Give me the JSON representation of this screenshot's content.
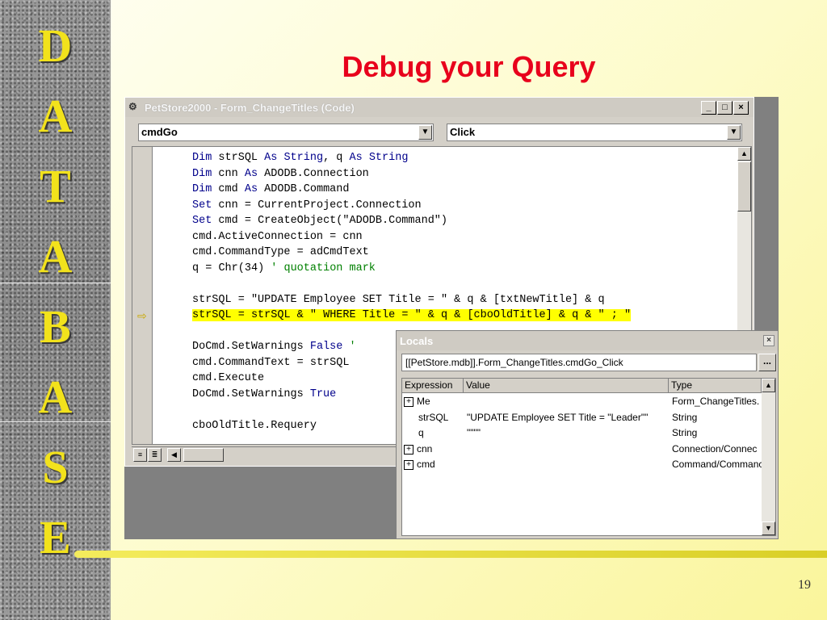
{
  "sidebar_letters": [
    "D",
    "A",
    "T",
    "A",
    "B",
    "A",
    "S",
    "E"
  ],
  "slide_title": "Debug your Query",
  "page_number": "19",
  "code_window": {
    "title": "PetStore2000 - Form_ChangeTitles (Code)",
    "object_combo": "cmdGo",
    "procedure_combo": "Click",
    "lines": [
      "Dim strSQL As String, q As String",
      "Dim cnn As ADODB.Connection",
      "Dim cmd As ADODB.Command",
      "Set cnn = CurrentProject.Connection",
      "Set cmd = CreateObject(\"ADODB.Command\")",
      "cmd.ActiveConnection = cnn",
      "cmd.CommandType = adCmdText",
      "q = Chr(34) ' quotation mark",
      "",
      "strSQL = \"UPDATE Employee SET Title = \" & q & [txtNewTitle] & q",
      "strSQL = strSQL & \" WHERE Title = \" & q & [cboOldTitle] & q & \" ; \"",
      "",
      "DoCmd.SetWarnings False '",
      "cmd.CommandText = strSQL",
      "cmd.Execute",
      "DoCmd.SetWarnings True",
      "",
      "cboOldTitle.Requery"
    ],
    "highlighted_line": 10
  },
  "locals_window": {
    "title": "Locals",
    "context": "[[PetStore.mdb]].Form_ChangeTitles.cmdGo_Click",
    "context_button": "...",
    "columns": [
      "Expression",
      "Value",
      "Type"
    ],
    "rows": [
      {
        "expand": "+",
        "expression": "Me",
        "value": "",
        "type": "Form_ChangeTitles."
      },
      {
        "expand": "",
        "expression": "strSQL",
        "value": "\"UPDATE Employee SET Title = \"Leader\"\"",
        "type": "String"
      },
      {
        "expand": "",
        "expression": "q",
        "value": "\"\"\"\"",
        "type": "String"
      },
      {
        "expand": "+",
        "expression": "cnn",
        "value": "",
        "type": "Connection/Connec"
      },
      {
        "expand": "+",
        "expression": "cmd",
        "value": "",
        "type": "Command/Commanc"
      }
    ]
  },
  "colors": {
    "title_red": "#e8001c",
    "letter_yellow": "#f2e21c",
    "keyword_blue": "#00008b",
    "comment_green": "#008000",
    "highlight_yellow": "#ffff00"
  }
}
